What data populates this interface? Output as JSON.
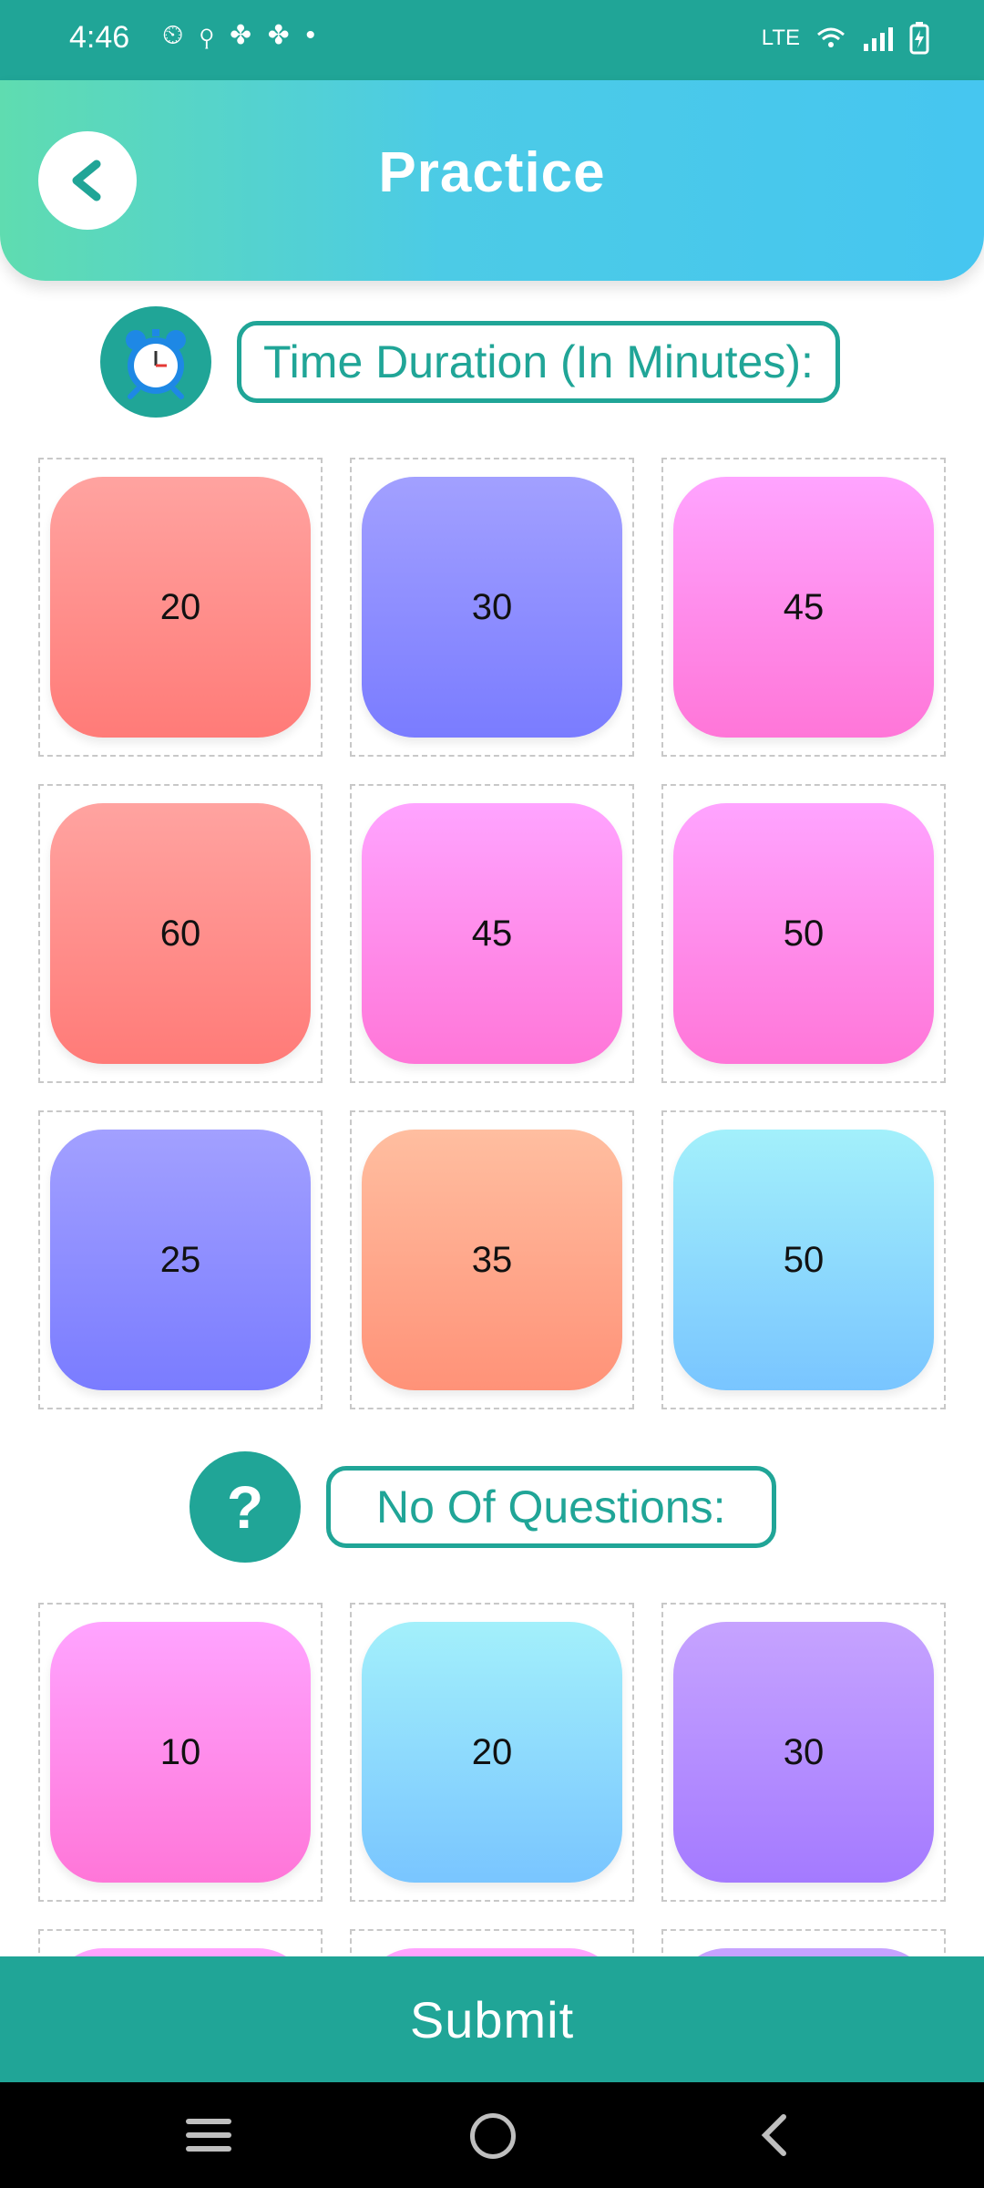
{
  "status_bar": {
    "time": "4:46",
    "network_label": "LTE",
    "icons": [
      "alarm-icon",
      "location-icon",
      "fan-icon",
      "fan-icon",
      "dot-icon",
      "wifi-icon",
      "signal-icon",
      "battery-charging-icon"
    ]
  },
  "header": {
    "title": "Practice",
    "back_icon": "chevron-left-icon"
  },
  "time_section": {
    "label": "Time Duration (In Minutes):",
    "icon": "alarm-clock-icon",
    "options": [
      {
        "value": "20",
        "gradient": [
          "#ffa3a0",
          "#ff7b78"
        ]
      },
      {
        "value": "30",
        "gradient": [
          "#a2a0ff",
          "#7a7cff"
        ]
      },
      {
        "value": "45",
        "gradient": [
          "#ffa4ff",
          "#ff76d8"
        ]
      },
      {
        "value": "60",
        "gradient": [
          "#ffa3a0",
          "#ff7b78"
        ]
      },
      {
        "value": "45",
        "gradient": [
          "#ffa4ff",
          "#ff76d8"
        ]
      },
      {
        "value": "50",
        "gradient": [
          "#ffa4ff",
          "#ff76d8"
        ]
      },
      {
        "value": "25",
        "gradient": [
          "#a2a0ff",
          "#7a7cff"
        ]
      },
      {
        "value": "35",
        "gradient": [
          "#ffbea0",
          "#ff9278"
        ]
      },
      {
        "value": "50",
        "gradient": [
          "#a3f0fb",
          "#79c5ff"
        ]
      }
    ]
  },
  "questions_section": {
    "label": "No Of Questions:",
    "icon": "question-mark-icon",
    "options": [
      {
        "value": "10",
        "gradient": [
          "#ffa4ff",
          "#ff76d8"
        ]
      },
      {
        "value": "20",
        "gradient": [
          "#a3f0fb",
          "#79c5ff"
        ]
      },
      {
        "value": "30",
        "gradient": [
          "#c6a3ff",
          "#a47aff"
        ]
      }
    ],
    "partial_row_gradients": [
      [
        "#ffa4ff",
        "#ff76d8"
      ],
      [
        "#ffa4ff",
        "#ff76d8"
      ],
      [
        "#c6a3ff",
        "#a47aff"
      ]
    ]
  },
  "submit": {
    "label": "Submit"
  },
  "colors": {
    "primary": "#20a597",
    "header_start": "#5fdcb0",
    "header_end": "#46c6f0"
  }
}
